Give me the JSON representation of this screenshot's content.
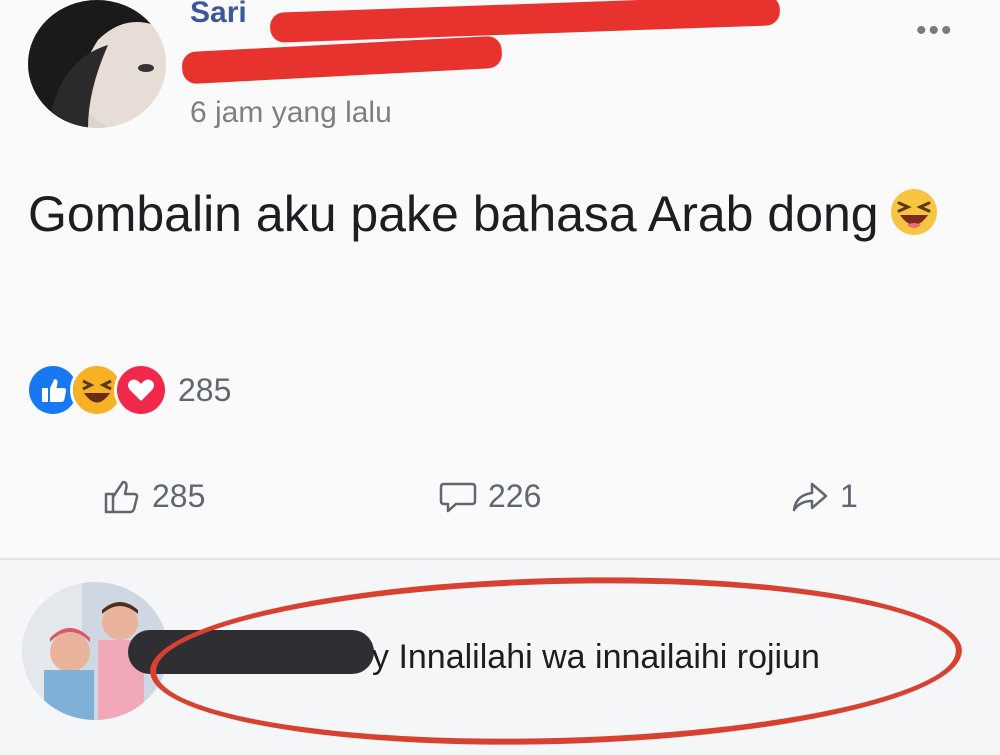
{
  "post": {
    "author": "Sari",
    "time": "6 jam yang lalu",
    "more": "•••",
    "text": "Gombalin aku pake bahasa Arab dong",
    "text_emoji": "laughing-emoji"
  },
  "reactions": {
    "types": [
      "like",
      "haha",
      "love"
    ],
    "count": "285"
  },
  "actions": {
    "like_count": "285",
    "comment_count": "226",
    "share_count": "1"
  },
  "comment": {
    "author_last_char": "y",
    "text": "Innalilahi wa innailaihi rojiun"
  },
  "colors": {
    "accent": "#3b5998",
    "like": "#1877f2",
    "love": "#f0284a",
    "haha": "#f7b125",
    "highlight": "#d8402f"
  }
}
